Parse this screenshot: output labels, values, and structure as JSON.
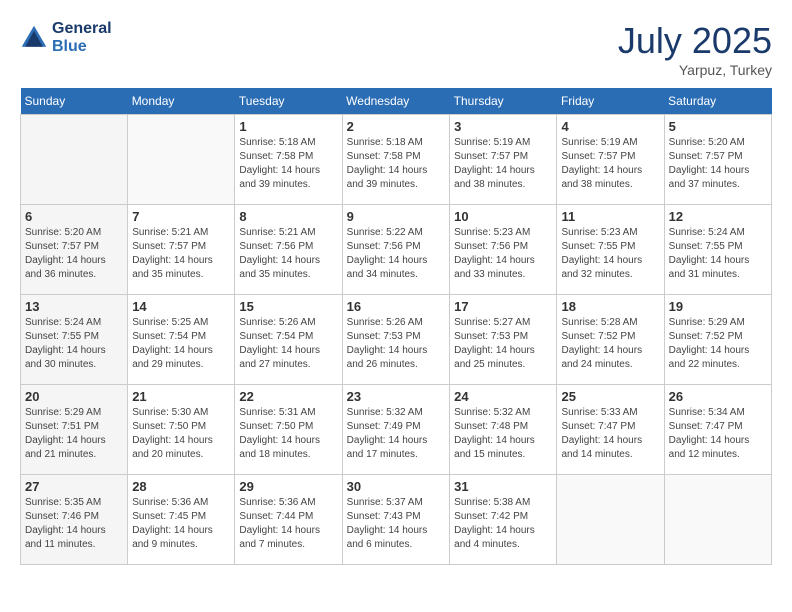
{
  "header": {
    "logo_line1": "General",
    "logo_line2": "Blue",
    "month": "July 2025",
    "location": "Yarpuz, Turkey"
  },
  "weekdays": [
    "Sunday",
    "Monday",
    "Tuesday",
    "Wednesday",
    "Thursday",
    "Friday",
    "Saturday"
  ],
  "weeks": [
    [
      {
        "day": "",
        "info": ""
      },
      {
        "day": "",
        "info": ""
      },
      {
        "day": "1",
        "info": "Sunrise: 5:18 AM\nSunset: 7:58 PM\nDaylight: 14 hours and 39 minutes."
      },
      {
        "day": "2",
        "info": "Sunrise: 5:18 AM\nSunset: 7:58 PM\nDaylight: 14 hours and 39 minutes."
      },
      {
        "day": "3",
        "info": "Sunrise: 5:19 AM\nSunset: 7:57 PM\nDaylight: 14 hours and 38 minutes."
      },
      {
        "day": "4",
        "info": "Sunrise: 5:19 AM\nSunset: 7:57 PM\nDaylight: 14 hours and 38 minutes."
      },
      {
        "day": "5",
        "info": "Sunrise: 5:20 AM\nSunset: 7:57 PM\nDaylight: 14 hours and 37 minutes."
      }
    ],
    [
      {
        "day": "6",
        "info": "Sunrise: 5:20 AM\nSunset: 7:57 PM\nDaylight: 14 hours and 36 minutes."
      },
      {
        "day": "7",
        "info": "Sunrise: 5:21 AM\nSunset: 7:57 PM\nDaylight: 14 hours and 35 minutes."
      },
      {
        "day": "8",
        "info": "Sunrise: 5:21 AM\nSunset: 7:56 PM\nDaylight: 14 hours and 35 minutes."
      },
      {
        "day": "9",
        "info": "Sunrise: 5:22 AM\nSunset: 7:56 PM\nDaylight: 14 hours and 34 minutes."
      },
      {
        "day": "10",
        "info": "Sunrise: 5:23 AM\nSunset: 7:56 PM\nDaylight: 14 hours and 33 minutes."
      },
      {
        "day": "11",
        "info": "Sunrise: 5:23 AM\nSunset: 7:55 PM\nDaylight: 14 hours and 32 minutes."
      },
      {
        "day": "12",
        "info": "Sunrise: 5:24 AM\nSunset: 7:55 PM\nDaylight: 14 hours and 31 minutes."
      }
    ],
    [
      {
        "day": "13",
        "info": "Sunrise: 5:24 AM\nSunset: 7:55 PM\nDaylight: 14 hours and 30 minutes."
      },
      {
        "day": "14",
        "info": "Sunrise: 5:25 AM\nSunset: 7:54 PM\nDaylight: 14 hours and 29 minutes."
      },
      {
        "day": "15",
        "info": "Sunrise: 5:26 AM\nSunset: 7:54 PM\nDaylight: 14 hours and 27 minutes."
      },
      {
        "day": "16",
        "info": "Sunrise: 5:26 AM\nSunset: 7:53 PM\nDaylight: 14 hours and 26 minutes."
      },
      {
        "day": "17",
        "info": "Sunrise: 5:27 AM\nSunset: 7:53 PM\nDaylight: 14 hours and 25 minutes."
      },
      {
        "day": "18",
        "info": "Sunrise: 5:28 AM\nSunset: 7:52 PM\nDaylight: 14 hours and 24 minutes."
      },
      {
        "day": "19",
        "info": "Sunrise: 5:29 AM\nSunset: 7:52 PM\nDaylight: 14 hours and 22 minutes."
      }
    ],
    [
      {
        "day": "20",
        "info": "Sunrise: 5:29 AM\nSunset: 7:51 PM\nDaylight: 14 hours and 21 minutes."
      },
      {
        "day": "21",
        "info": "Sunrise: 5:30 AM\nSunset: 7:50 PM\nDaylight: 14 hours and 20 minutes."
      },
      {
        "day": "22",
        "info": "Sunrise: 5:31 AM\nSunset: 7:50 PM\nDaylight: 14 hours and 18 minutes."
      },
      {
        "day": "23",
        "info": "Sunrise: 5:32 AM\nSunset: 7:49 PM\nDaylight: 14 hours and 17 minutes."
      },
      {
        "day": "24",
        "info": "Sunrise: 5:32 AM\nSunset: 7:48 PM\nDaylight: 14 hours and 15 minutes."
      },
      {
        "day": "25",
        "info": "Sunrise: 5:33 AM\nSunset: 7:47 PM\nDaylight: 14 hours and 14 minutes."
      },
      {
        "day": "26",
        "info": "Sunrise: 5:34 AM\nSunset: 7:47 PM\nDaylight: 14 hours and 12 minutes."
      }
    ],
    [
      {
        "day": "27",
        "info": "Sunrise: 5:35 AM\nSunset: 7:46 PM\nDaylight: 14 hours and 11 minutes."
      },
      {
        "day": "28",
        "info": "Sunrise: 5:36 AM\nSunset: 7:45 PM\nDaylight: 14 hours and 9 minutes."
      },
      {
        "day": "29",
        "info": "Sunrise: 5:36 AM\nSunset: 7:44 PM\nDaylight: 14 hours and 7 minutes."
      },
      {
        "day": "30",
        "info": "Sunrise: 5:37 AM\nSunset: 7:43 PM\nDaylight: 14 hours and 6 minutes."
      },
      {
        "day": "31",
        "info": "Sunrise: 5:38 AM\nSunset: 7:42 PM\nDaylight: 14 hours and 4 minutes."
      },
      {
        "day": "",
        "info": ""
      },
      {
        "day": "",
        "info": ""
      }
    ]
  ]
}
